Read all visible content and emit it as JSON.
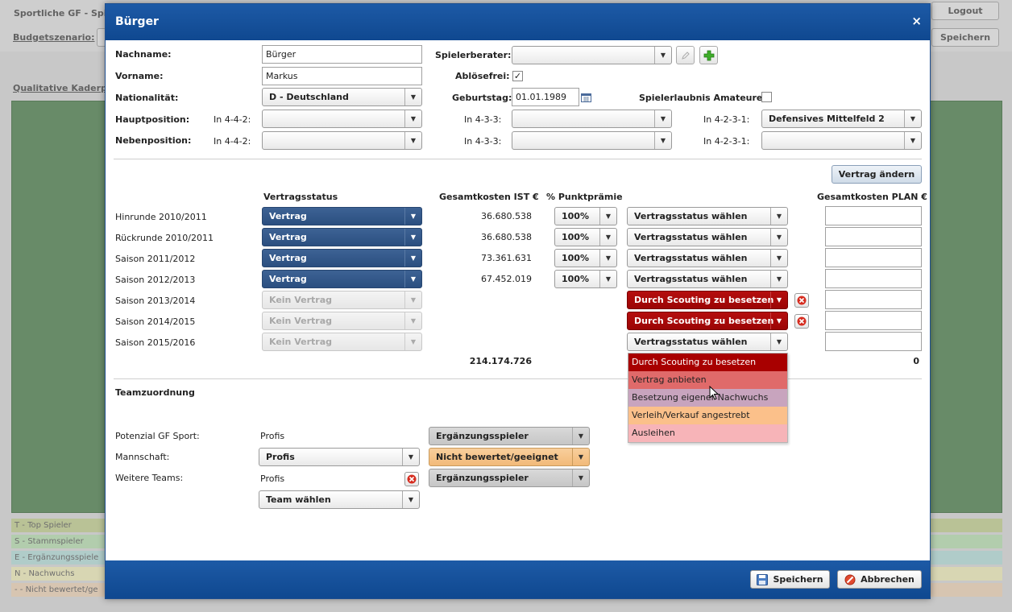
{
  "background": {
    "title": "Sportliche GF - Spie",
    "budget_label": "Budgetszenario:",
    "logout_label": "Logout",
    "save_label": "Speichern",
    "kader_label": "Qualitative Kaderpla",
    "legend": [
      "T - Top Spieler",
      "S - Stammspieler",
      "E - Ergänzungsspiele",
      "N - Nachwuchs",
      "- - Nicht bewertet/ge"
    ]
  },
  "modal": {
    "title": "Bürger",
    "close": "×",
    "nachname_label": "Nachname:",
    "nachname_value": "Bürger",
    "vorname_label": "Vorname:",
    "vorname_value": "Markus",
    "nationalitaet_label": "Nationalität:",
    "nationalitaet_value": "D - Deutschland",
    "hauptposition_label": "Hauptposition:",
    "nebenposition_label": "Nebenposition:",
    "in442": "In 4-4-2:",
    "in433": "In 4-3-3:",
    "in4231": "In 4-2-3-1:",
    "hauptposition_4231_value": "Defensives Mittelfeld 2",
    "spielerberater_label": "Spielerberater:",
    "abloesefrei_label": "Ablösefrei:",
    "geburtstag_label": "Geburtstag:",
    "geburtstag_value": "01.01.1989",
    "spielerlaubnis_label": "Spielerlaubnis Amateure:",
    "vertrag_aendern": "Vertrag ändern",
    "col_vertragsstatus": "Vertragsstatus",
    "col_gesamtkosten_ist": "Gesamtkosten IST €",
    "col_punktpraemie": "% Punktprämie",
    "col_gesamtkosten_plan": "Gesamtkosten PLAN €",
    "seasons": [
      {
        "label": "Hinrunde 2010/2011",
        "status": "Vertrag",
        "kosten": "36.680.538",
        "praemie": "100%",
        "plan_status": "Vertragsstatus wählen"
      },
      {
        "label": "Rückrunde 2010/2011",
        "status": "Vertrag",
        "kosten": "36.680.538",
        "praemie": "100%",
        "plan_status": "Vertragsstatus wählen"
      },
      {
        "label": "Saison 2011/2012",
        "status": "Vertrag",
        "kosten": "73.361.631",
        "praemie": "100%",
        "plan_status": "Vertragsstatus wählen"
      },
      {
        "label": "Saison 2012/2013",
        "status": "Vertrag",
        "kosten": "67.452.019",
        "praemie": "100%",
        "plan_status": "Vertragsstatus wählen"
      },
      {
        "label": "Saison 2013/2014",
        "status": "Kein Vertrag",
        "plan_status": "Durch Scouting zu besetzen"
      },
      {
        "label": "Saison 2014/2015",
        "status": "Kein Vertrag",
        "plan_status": "Durch Scouting zu besetzen"
      },
      {
        "label": "Saison 2015/2016",
        "status": "Kein Vertrag",
        "plan_status": "Vertragsstatus wählen"
      }
    ],
    "total_ist": "214.174.726",
    "total_plan": "0",
    "dropdown_options": [
      {
        "label": "Durch Scouting zu besetzen",
        "bg": "#a80000",
        "fg": "#ffffff"
      },
      {
        "label": "Vertrag anbieten",
        "bg": "#e06a6a",
        "fg": "#222222"
      },
      {
        "label": "Besetzung eigener Nachwuchs",
        "bg": "#c8a4be",
        "fg": "#222222"
      },
      {
        "label": "Verleih/Verkauf angestrebt",
        "bg": "#fbc08a",
        "fg": "#222222"
      },
      {
        "label": "Ausleihen",
        "bg": "#f7b4b8",
        "fg": "#222222"
      }
    ],
    "teamzuordnung_label": "Teamzuordnung",
    "potenzial_label": "Potenzial GF Sport:",
    "potenzial_value": "Profis",
    "potenzial_select": "Ergänzungsspieler",
    "mannschaft_label": "Mannschaft:",
    "mannschaft_value": "Profis",
    "mannschaft_select": "Nicht bewertet/geeignet",
    "weitere_label": "Weitere Teams:",
    "weitere_value": "Profis",
    "weitere_select": "Ergänzungsspieler",
    "team_waehlen": "Team wählen",
    "save_button": "Speichern",
    "cancel_button": "Abbrechen"
  },
  "colors": {
    "header_blue": "#1d5aa6",
    "contract_blue": "#2e5283",
    "scouting_red": "#a80000"
  }
}
